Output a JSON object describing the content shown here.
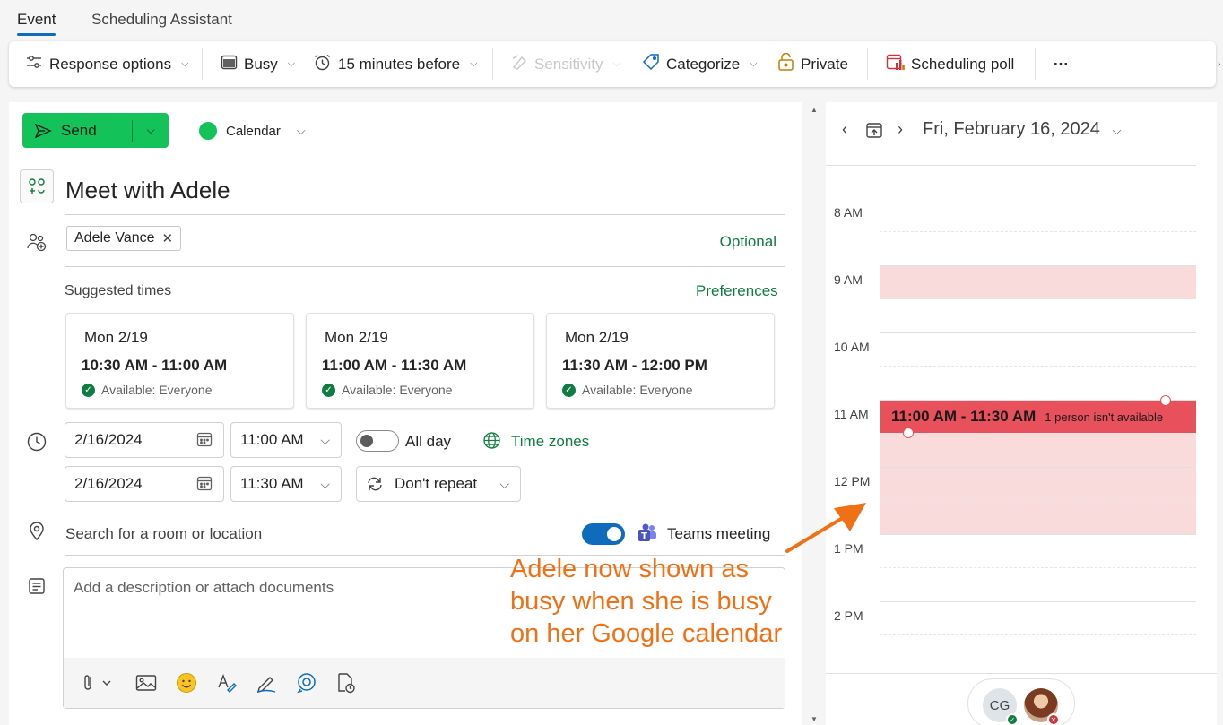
{
  "tabs": [
    {
      "label": "Event"
    },
    {
      "label": "Scheduling Assistant"
    }
  ],
  "ribbon": {
    "response_options": "Response options",
    "busy": "Busy",
    "reminder": "15 minutes before",
    "sensitivity": "Sensitivity",
    "categorize": "Categorize",
    "private": "Private",
    "scheduling_poll": "Scheduling poll",
    "more": "···"
  },
  "compose": {
    "send_label": "Send",
    "calendar_label": "Calendar",
    "title": "Meet with Adele",
    "attendee": "Adele Vance",
    "optional_label": "Optional",
    "suggested_label": "Suggested times",
    "preferences_label": "Preferences",
    "suggestions": [
      {
        "day": "Mon 2/19",
        "time": "10:30 AM - 11:00 AM",
        "avail": "Available: Everyone"
      },
      {
        "day": "Mon 2/19",
        "time": "11:00 AM - 11:30 AM",
        "avail": "Available: Everyone"
      },
      {
        "day": "Mon 2/19",
        "time": "11:30 AM - 12:00 PM",
        "avail": "Available: Everyone"
      }
    ],
    "start_date": "2/16/2024",
    "start_time": "11:00 AM",
    "end_date": "2/16/2024",
    "end_time": "11:30 AM",
    "all_day_label": "All day",
    "all_day_on": false,
    "time_zones_label": "Time zones",
    "repeat_label": "Don't repeat",
    "location_placeholder": "Search for a room or location",
    "teams_label": "Teams meeting",
    "teams_on": true,
    "description_placeholder": "Add a description or attach documents"
  },
  "calendar": {
    "date_label": "Fri, February 16, 2024",
    "hours": [
      "8 AM",
      "9 AM",
      "10 AM",
      "11 AM",
      "12 PM",
      "1 PM",
      "2 PM"
    ],
    "event_time": "11:00 AM - 11:30 AM",
    "event_status": "1 person isn't available",
    "avatar_initials": "CG"
  },
  "annotation": "Adele now shown as busy when she is busy on her Google calendar",
  "colors": {
    "accent_blue": "#0f6cbd",
    "send_green": "#13c35a",
    "event_red": "#e8505b",
    "busy_pink": "#fadbdc",
    "annotation_orange": "#f07016"
  }
}
